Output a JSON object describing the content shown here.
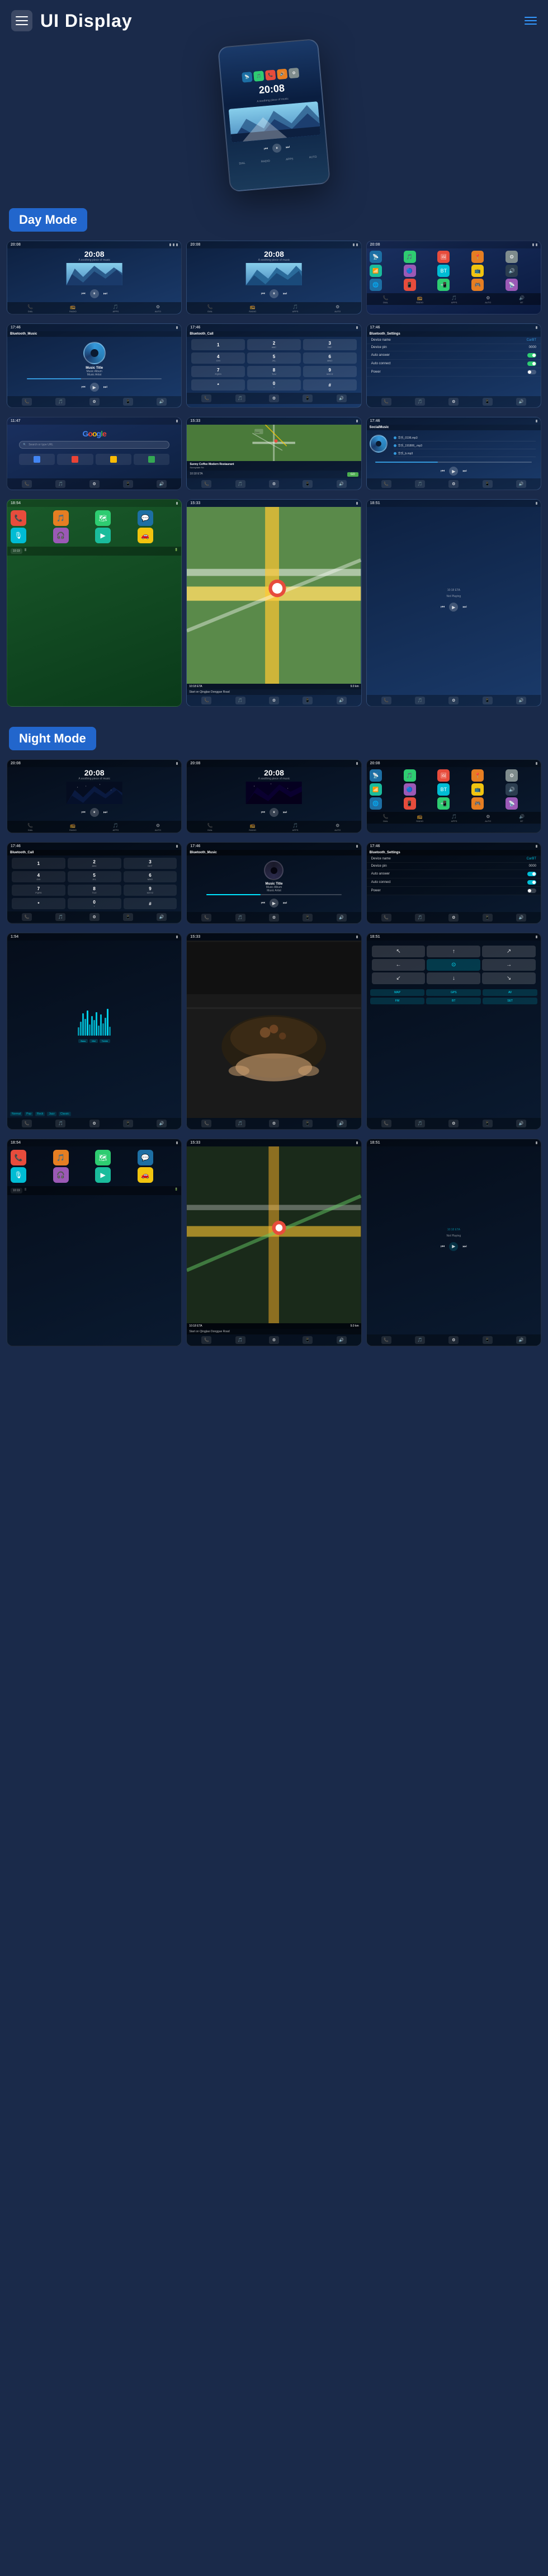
{
  "header": {
    "title": "UI Display",
    "menu_icon": "menu-icon",
    "lines_icon": "lines-icon"
  },
  "day_mode": {
    "label": "Day Mode"
  },
  "night_mode": {
    "label": "Night Mode"
  },
  "music": {
    "title": "Music Title",
    "album": "Music Album",
    "artist": "Music Artist"
  },
  "time": {
    "display": "20:08",
    "subtitle": "A soothing piece of music"
  },
  "settings": {
    "device_name_label": "Device name",
    "device_name_value": "CarBT",
    "device_pin_label": "Device pin",
    "device_pin_value": "0000",
    "auto_answer_label": "Auto answer",
    "auto_connect_label": "Auto connect",
    "power_label": "Power"
  },
  "navigation": {
    "eta_label": "10:18 ETA",
    "distance_label": "9.0 km",
    "route_label": "Start on Qingjiao Donggue Road",
    "not_playing_label": "Not Playing"
  },
  "coffee": {
    "name": "Sunny Coffee Modern Restaurant",
    "address": "Sunnydale Rd",
    "go_label": "GO"
  },
  "bluetooth": {
    "call_label": "Bluetooth_Call",
    "music_label": "Bluetooth_Music",
    "settings_label": "Bluetooth_Settings"
  },
  "social": {
    "header": "SocialMusic",
    "tracks": [
      "华乐_0196.mp3",
      "华乐_191806_.mp3",
      "华乐_b.mp3"
    ]
  },
  "google": {
    "logo": "Google"
  },
  "dial_keys": [
    {
      "num": "1",
      "sub": ""
    },
    {
      "num": "2",
      "sub": "ABC"
    },
    {
      "num": "3",
      "sub": "DEF"
    },
    {
      "num": "4",
      "sub": "GHI"
    },
    {
      "num": "5",
      "sub": "JKL"
    },
    {
      "num": "6",
      "sub": "MNO"
    },
    {
      "num": "7",
      "sub": "PQRS"
    },
    {
      "num": "8",
      "sub": "TUV"
    },
    {
      "num": "9",
      "sub": "WXYZ"
    },
    {
      "num": "*",
      "sub": ""
    },
    {
      "num": "0",
      "sub": "+"
    },
    {
      "num": "#",
      "sub": ""
    }
  ],
  "nav_items": [
    {
      "icon": "📞",
      "label": "DIAL"
    },
    {
      "icon": "📻",
      "label": "RADIO"
    },
    {
      "icon": "🎵",
      "label": "APPS"
    },
    {
      "icon": "⚙",
      "label": "AUTO"
    },
    {
      "icon": "🔊",
      "label": "BT"
    }
  ]
}
